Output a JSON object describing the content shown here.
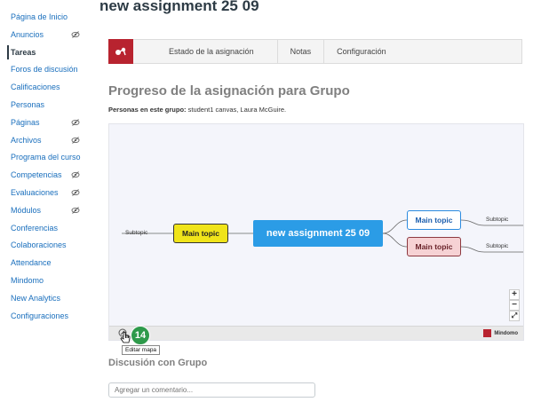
{
  "page": {
    "title": "new assignment 25 09"
  },
  "sidebar": {
    "items": [
      {
        "label": "Página de Inicio",
        "hidden": false,
        "active": false
      },
      {
        "label": "Anuncios",
        "hidden": true,
        "active": false
      },
      {
        "label": "Tareas",
        "hidden": false,
        "active": true
      },
      {
        "label": "Foros de discusión",
        "hidden": false,
        "active": false
      },
      {
        "label": "Calificaciones",
        "hidden": false,
        "active": false
      },
      {
        "label": "Personas",
        "hidden": false,
        "active": false
      },
      {
        "label": "Páginas",
        "hidden": true,
        "active": false
      },
      {
        "label": "Archivos",
        "hidden": true,
        "active": false
      },
      {
        "label": "Programa del curso",
        "hidden": false,
        "active": false
      },
      {
        "label": "Competencias",
        "hidden": true,
        "active": false
      },
      {
        "label": "Evaluaciones",
        "hidden": true,
        "active": false
      },
      {
        "label": "Módulos",
        "hidden": true,
        "active": false
      },
      {
        "label": "Conferencias",
        "hidden": false,
        "active": false
      },
      {
        "label": "Colaboraciones",
        "hidden": false,
        "active": false
      },
      {
        "label": "Attendance",
        "hidden": false,
        "active": false
      },
      {
        "label": "Mindomo",
        "hidden": false,
        "active": false
      },
      {
        "label": "New Analytics",
        "hidden": false,
        "active": false
      },
      {
        "label": "Configuraciones",
        "hidden": false,
        "active": false
      }
    ]
  },
  "plugin": {
    "tabs": [
      "Estado de la asignación",
      "Notas",
      "Configuración"
    ]
  },
  "progress": {
    "title": "Progreso de la asignación para Grupo",
    "group_label": "Personas en este grupo:",
    "group_members": " student1 canvas, Laura McGuire."
  },
  "map": {
    "center": "new assignment 25 09",
    "left_topic": "Main topic",
    "left_subtopic": "Subtopic",
    "right_topic_1": "Main topic",
    "right_subtopic_1": "Subtopic",
    "right_topic_2": "Main topic",
    "right_subtopic_2": "Subtopic",
    "zoom_in": "+",
    "zoom_out": "−",
    "fit": "⤢",
    "brand": "Mindomo",
    "edit_tooltip": "Editar mapa",
    "badge_count": "14"
  },
  "colors": {
    "accent": "#1a6fbd",
    "brand_red": "#b8232f",
    "center_node": "#2b9ce6",
    "yellow_node": "#f0e41a",
    "red_node": "#f6d2d4",
    "badge": "#2e9a4b"
  },
  "discussion": {
    "title": "Discusión con Grupo",
    "placeholder": "Agregar un comentario..."
  }
}
